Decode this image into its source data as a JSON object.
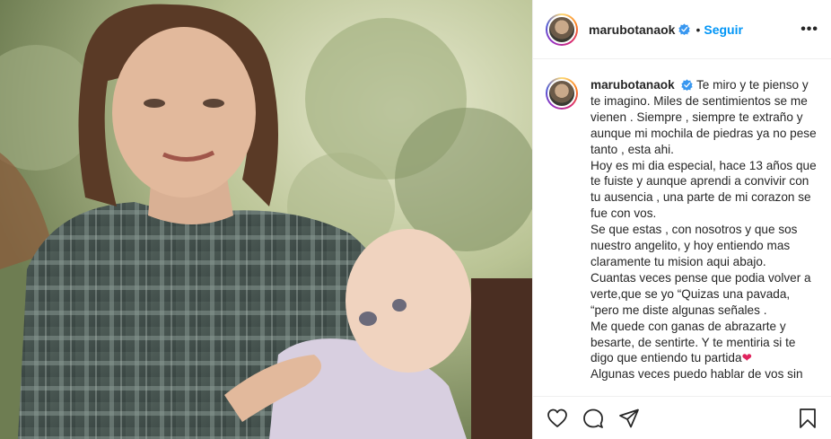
{
  "post": {
    "username": "marubotanaok",
    "separator": "•",
    "follow_label": "Seguir",
    "more_label": "•••",
    "caption": {
      "username": "marubotanaok",
      "text": "Te miro y te pienso y te imagino. Miles de sentimientos se me vienen . Siempre , siempre te extraño y aunque mi mochila de piedras ya no pese tanto , esta ahi.\nHoy es mi dia especial, hace 13 años que te fuiste y aunque aprendi a convivir con tu ausencia , una parte de mi corazon se fue con vos.\nSe que estas , con nosotros y que sos nuestro angelito, y hoy entiendo mas claramente tu mision aqui abajo.\nCuantas veces pense que podia volver a verte,que se yo “Quizas una pavada, “pero me diste algunas señales .\nMe quede con ganas de abrazarte y besarte, de sentirte. Y te mentiria si te digo que entiendo tu partida",
      "emoji": "❤",
      "text_after": "\nAlgunas veces puedo hablar de vos sin"
    }
  },
  "icons": {
    "verified": "verified-badge-icon",
    "like": "heart-outline-icon",
    "comment": "comment-bubble-icon",
    "share": "paper-plane-icon",
    "save": "bookmark-icon"
  },
  "colors": {
    "accent": "#0095f6",
    "text": "#262626",
    "divider": "#efefef",
    "heart": "#e0245e"
  }
}
